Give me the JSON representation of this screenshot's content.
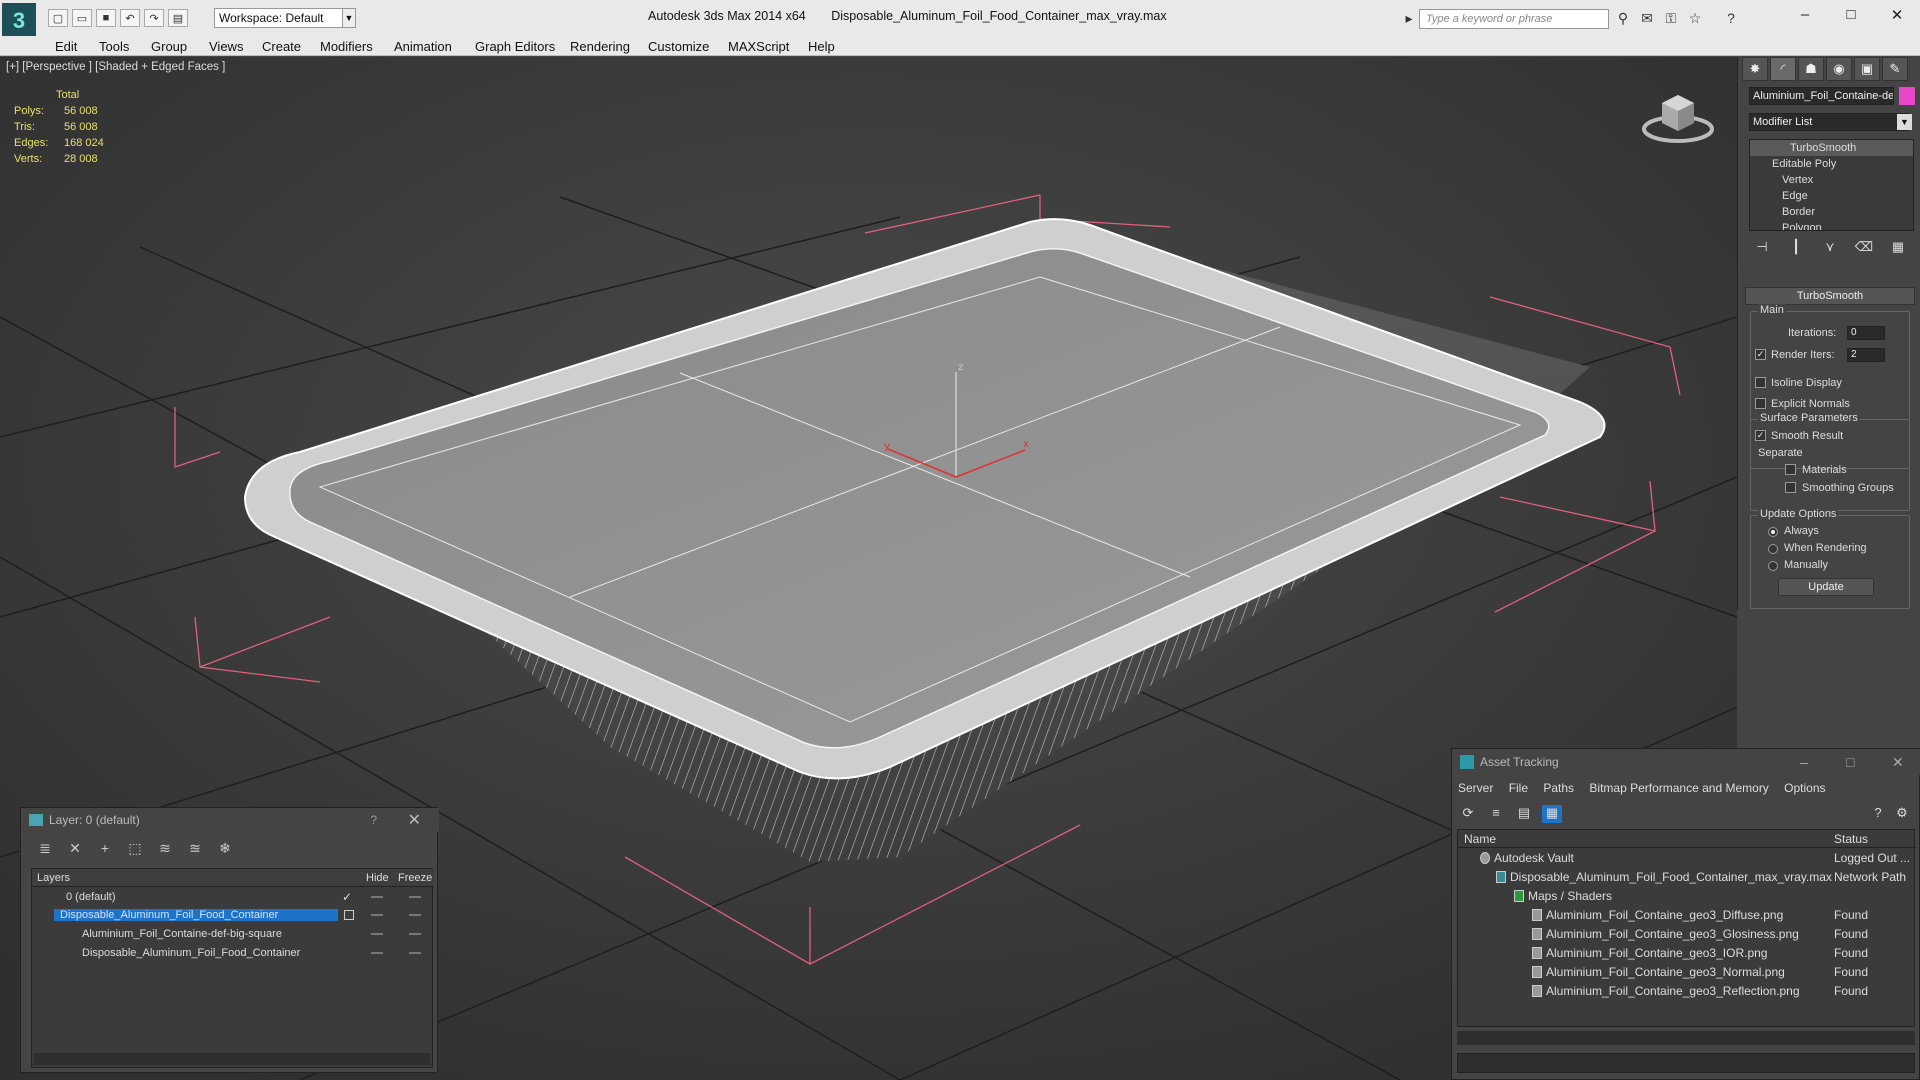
{
  "app": {
    "name": "Autodesk 3ds Max  2014 x64",
    "file": "Disposable_Aluminum_Foil_Food_Container_max_vray.max",
    "workspace": "Workspace: Default",
    "search_placeholder": "Type a keyword or phrase"
  },
  "menu": [
    "Edit",
    "Tools",
    "Group",
    "Views",
    "Create",
    "Modifiers",
    "Animation",
    "Graph Editors",
    "Rendering",
    "Customize",
    "MAXScript",
    "Help"
  ],
  "viewport": {
    "label": "[+] [Perspective ] [Shaded + Edged Faces ]",
    "stats": {
      "total_label": "Total",
      "rows": [
        {
          "k": "Polys:",
          "v": "56 008"
        },
        {
          "k": "Tris:",
          "v": "56 008"
        },
        {
          "k": "Edges:",
          "v": "168 024"
        },
        {
          "k": "Verts:",
          "v": "28 008"
        }
      ]
    },
    "axis": {
      "x": "x",
      "y": "y",
      "z": "z"
    }
  },
  "command_panel": {
    "object_name": "Aluminium_Foil_Containe-def",
    "object_color": "#e848c8",
    "modifier_list": "Modifier List",
    "stack": [
      "TurboSmooth",
      "Editable Poly",
      "Vertex",
      "Edge",
      "Border",
      "Polygon"
    ],
    "rollout_title": "TurboSmooth",
    "main_label": "Main",
    "iterations_label": "Iterations:",
    "iterations_value": "0",
    "render_iters_label": "Render Iters:",
    "render_iters_value": "2",
    "isoline": "Isoline Display",
    "explicit_normals": "Explicit Normals",
    "surface_params": "Surface Parameters",
    "smooth_result": "Smooth Result",
    "separate": "Separate",
    "materials": "Materials",
    "smoothing_groups": "Smoothing Groups",
    "update_options": "Update Options",
    "always": "Always",
    "when_rendering": "When Rendering",
    "manually": "Manually",
    "update_button": "Update"
  },
  "layer_panel": {
    "title": "Layer: 0 (default)",
    "help": "?",
    "col_layers": "Layers",
    "col_hide": "Hide",
    "col_freeze": "Freeze",
    "rows": [
      "0 (default)",
      "Disposable_Aluminum_Foil_Food_Container",
      "Aluminium_Foil_Containe-def-big-square",
      "Disposable_Aluminum_Foil_Food_Container"
    ]
  },
  "asset_tracking": {
    "title": "Asset Tracking",
    "menu": [
      "Server",
      "File",
      "Paths",
      "Bitmap Performance and Memory",
      "Options"
    ],
    "col_name": "Name",
    "col_status": "Status",
    "rows": [
      {
        "name": "Autodesk Vault",
        "status": "Logged Out ..."
      },
      {
        "name": "Disposable_Aluminum_Foil_Food_Container_max_vray.max",
        "status": "Network Path"
      },
      {
        "name": "Maps / Shaders",
        "status": ""
      },
      {
        "name": "Aluminium_Foil_Containe_geo3_Diffuse.png",
        "status": "Found"
      },
      {
        "name": "Aluminium_Foil_Containe_geo3_Glosiness.png",
        "status": "Found"
      },
      {
        "name": "Aluminium_Foil_Containe_geo3_IOR.png",
        "status": "Found"
      },
      {
        "name": "Aluminium_Foil_Containe_geo3_Normal.png",
        "status": "Found"
      },
      {
        "name": "Aluminium_Foil_Containe_geo3_Reflection.png",
        "status": "Found"
      }
    ]
  }
}
